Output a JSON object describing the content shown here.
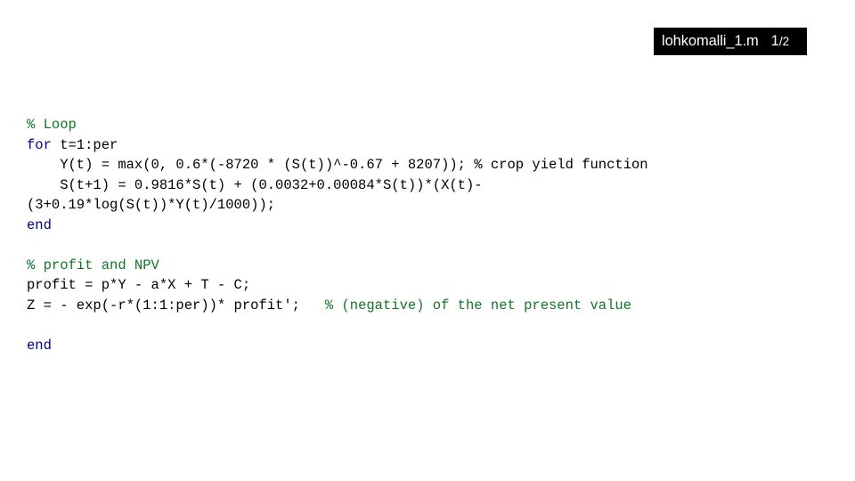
{
  "header": {
    "file_name": "lohkomalli_1.m",
    "page_number": "1",
    "page_separator": "/2",
    "background_color": "#000000",
    "text_color": "#ffffff"
  },
  "colors": {
    "comment_green": "#127527",
    "keyword_blue": "#000080",
    "code_black": "#000000",
    "page_background": "#ffffff"
  },
  "code": {
    "language": "matlab",
    "lines": [
      {
        "id": "line-1",
        "segments": [
          {
            "text": "% Loop",
            "style": "comment-green"
          }
        ]
      },
      {
        "id": "line-2",
        "segments": [
          {
            "text": "for",
            "style": "keyword"
          },
          {
            "text": " t=1:per",
            "style": "plain"
          }
        ]
      },
      {
        "id": "line-3",
        "segments": [
          {
            "text": "    Y(t) = max(0, 0.6*(-8720 * (S(t))^-0.67 + 8207)); % crop yield function",
            "style": "plain"
          }
        ]
      },
      {
        "id": "line-4",
        "segments": [
          {
            "text": "    S(t+1) = 0.9816*S(t) + (0.0032+0.00084*S(t))*(X(t)-",
            "style": "plain"
          }
        ]
      },
      {
        "id": "line-5",
        "segments": [
          {
            "text": "(3+0.19*log(S(t))*Y(t)/1000));",
            "style": "plain"
          }
        ]
      },
      {
        "id": "line-6",
        "segments": [
          {
            "text": "end",
            "style": "keyword"
          }
        ]
      },
      {
        "id": "line-7",
        "segments": []
      },
      {
        "id": "line-8",
        "segments": [
          {
            "text": "% profit and NPV",
            "style": "comment-green"
          }
        ]
      },
      {
        "id": "line-9",
        "segments": [
          {
            "text": "profit = p*Y - a*X + T - C;",
            "style": "plain"
          }
        ]
      },
      {
        "id": "line-10",
        "segments": [
          {
            "text": "Z = - exp(-r*(1:1:per))* profit';   ",
            "style": "plain"
          },
          {
            "text": "% (negative) of the net present value",
            "style": "comment-green"
          }
        ]
      },
      {
        "id": "line-11",
        "segments": []
      },
      {
        "id": "line-12",
        "segments": [
          {
            "text": "end",
            "style": "keyword"
          }
        ]
      }
    ]
  }
}
